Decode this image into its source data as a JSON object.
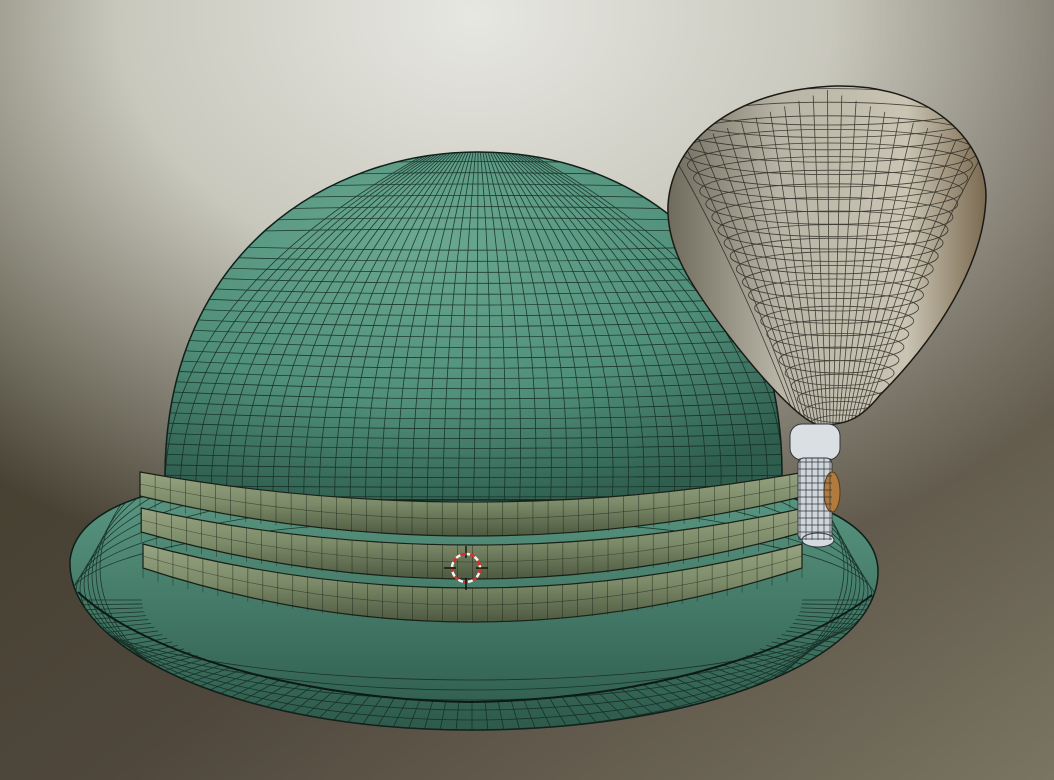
{
  "viewport": {
    "mode": "3d-viewport",
    "shading": "textured-wireframe-overlay",
    "background": {
      "top_center": "#e7e7e2",
      "upper_mid": "#c9c8bd",
      "left_dark": "#3c3a26",
      "bottom": "#4f473c",
      "right": "#7a7462"
    }
  },
  "objects": [
    {
      "name": "hat-crown",
      "color": "#4f8e78",
      "wire": "#142a22"
    },
    {
      "name": "hat-brim",
      "color": "#4e8a76",
      "wire": "#142a22"
    },
    {
      "name": "hat-band",
      "color": "#7e8d6c",
      "wire": "#1a2016"
    },
    {
      "name": "feather-cone",
      "color": "#a8a596",
      "wire": "#22221c"
    },
    {
      "name": "feather-stem",
      "color": "#d9dfe3",
      "wire": "#30363a"
    }
  ],
  "cursor": {
    "name": "3d-cursor",
    "ring_colors": [
      "#d8302a",
      "#f4f4f4"
    ]
  }
}
